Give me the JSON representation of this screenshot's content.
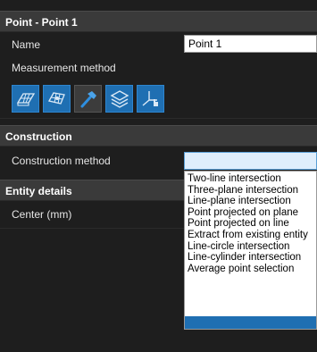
{
  "point_panel": {
    "header": "Point - Point 1",
    "name_label": "Name",
    "name_value": "Point 1",
    "measurement_method_label": "Measurement method",
    "tools": [
      {
        "icon": "surface-mesh-icon"
      },
      {
        "icon": "probe-mesh-icon"
      },
      {
        "icon": "construct-hammer-icon"
      },
      {
        "icon": "layers-icon"
      },
      {
        "icon": "axis-pointer-icon"
      }
    ]
  },
  "construction": {
    "header": "Construction",
    "method_label": "Construction method",
    "selected_value": "",
    "options": [
      "Two-line intersection",
      "Three-plane intersection",
      "Line-plane intersection",
      "Point projected on plane",
      "Point projected on line",
      "Extract from existing entity",
      "Line-circle intersection",
      "Line-cylinder intersection",
      "Average point selection"
    ]
  },
  "entity_details": {
    "header": "Entity details",
    "center_label": "Center (mm)"
  },
  "colors": {
    "accent": "#1f6fb2",
    "panel_bg": "#1e1e1e",
    "header_bg": "#3a3a3a"
  }
}
